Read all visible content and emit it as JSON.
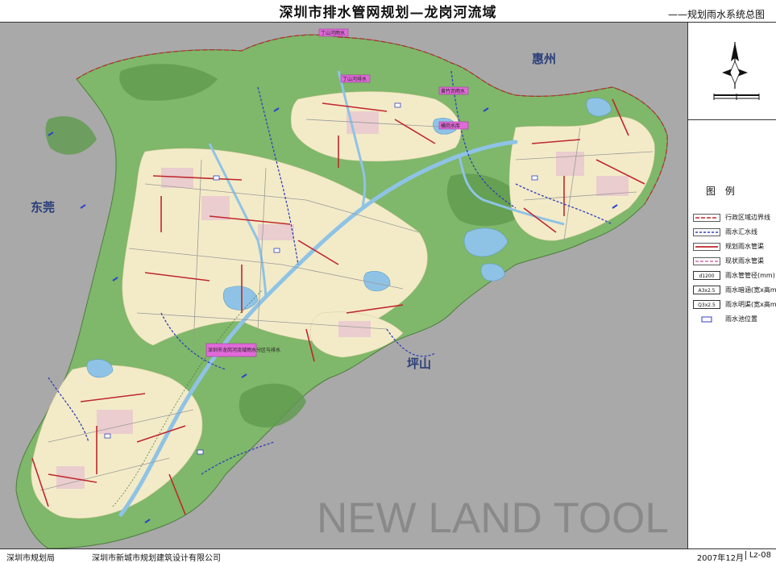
{
  "header": {
    "title": "深圳市排水管网规划—龙岗河流域",
    "subtitle": "——规划雨水系统总图"
  },
  "map": {
    "region_labels": {
      "dongguan": "东莞",
      "huizhou": "惠州",
      "pingshan": "坪山"
    },
    "watermark": "NEW LAND TOOL",
    "poi_labels": [
      "丁山河雨水",
      "丁山河排水",
      "黄竹沥雨水",
      "横岗水库",
      "深圳市龙岗河流域雨水分区与排水"
    ],
    "colors": {
      "outside": "#a9a9a9",
      "water": "#8fc3e6",
      "green": "#7fb76b",
      "urban": "#f3ebc8",
      "planned_pipe": "#c0272d",
      "catchment_line": "#3340b8",
      "district_boundary": "#c0272d"
    }
  },
  "legend": {
    "title": "图 例",
    "items": [
      {
        "symbol": "line-dash-red",
        "label": "行政区域边界线"
      },
      {
        "symbol": "line-dot-blue",
        "label": "雨水汇水线"
      },
      {
        "symbol": "line-solid-red",
        "label": "规划雨水管渠"
      },
      {
        "symbol": "line-dash-pink",
        "label": "现状雨水管渠"
      },
      {
        "symbol": "box",
        "box_text": "d1200",
        "label": "雨水管管径(mm)"
      },
      {
        "symbol": "box",
        "box_text": "A3x2.5",
        "label": "雨水暗涵(宽x高m)"
      },
      {
        "symbol": "box",
        "box_text": "Q3x2.5",
        "label": "雨水明渠(宽x高m)"
      },
      {
        "symbol": "rect-blue",
        "label": "雨水池位置"
      }
    ]
  },
  "footer": {
    "left": "深圳市规划局",
    "middle": "深圳市新城市规划建筑设计有限公司",
    "date": "2007年12月",
    "code": "Lz-08"
  }
}
